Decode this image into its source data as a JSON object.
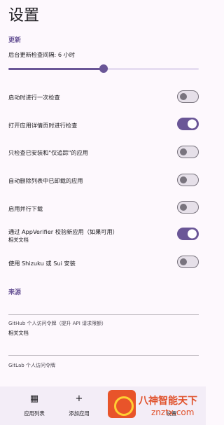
{
  "header": {
    "title": "设置"
  },
  "update": {
    "section_title": "更新",
    "interval_label": "后台更新检查间隔: 6 小时",
    "interval_hours": 6,
    "interval_fraction": 0.5,
    "toggles": [
      {
        "label": "启动时进行一次检查",
        "on": false
      },
      {
        "label": "打开应用详情页时进行检查",
        "on": true
      },
      {
        "label": "只检查已安装和\"仅追踪\"的应用",
        "on": false
      },
      {
        "label": "自动删除列表中已卸载的应用",
        "on": false
      },
      {
        "label": "启用并行下载",
        "on": false
      },
      {
        "label": "通过 AppVerifier 校验新应用（如果可用）",
        "on": true,
        "sub": "相关文档"
      },
      {
        "label": "使用 Shizuku 或 Sui 安装",
        "on": false
      }
    ]
  },
  "source": {
    "section_title": "来源",
    "github": {
      "label": "GitHub 个人访问令牌（提升 API 请求限额）",
      "doc": "相关文档"
    },
    "gitlab": {
      "label": "GitLab 个人访问令牌"
    }
  },
  "bottom_nav": {
    "items": [
      {
        "icon": "grid-icon",
        "glyph": "▦",
        "label": "应用列表"
      },
      {
        "icon": "plus-icon",
        "glyph": "+",
        "label": "添加应用"
      },
      {
        "icon": "settings-icon",
        "glyph": "",
        "label": "设置"
      }
    ]
  },
  "watermark": {
    "line1": "八神智能天下",
    "line2": "znztx.com"
  },
  "colors": {
    "accent": "#6a5697",
    "background": "#fdf8fd",
    "nav_bg": "#f3edf7"
  }
}
